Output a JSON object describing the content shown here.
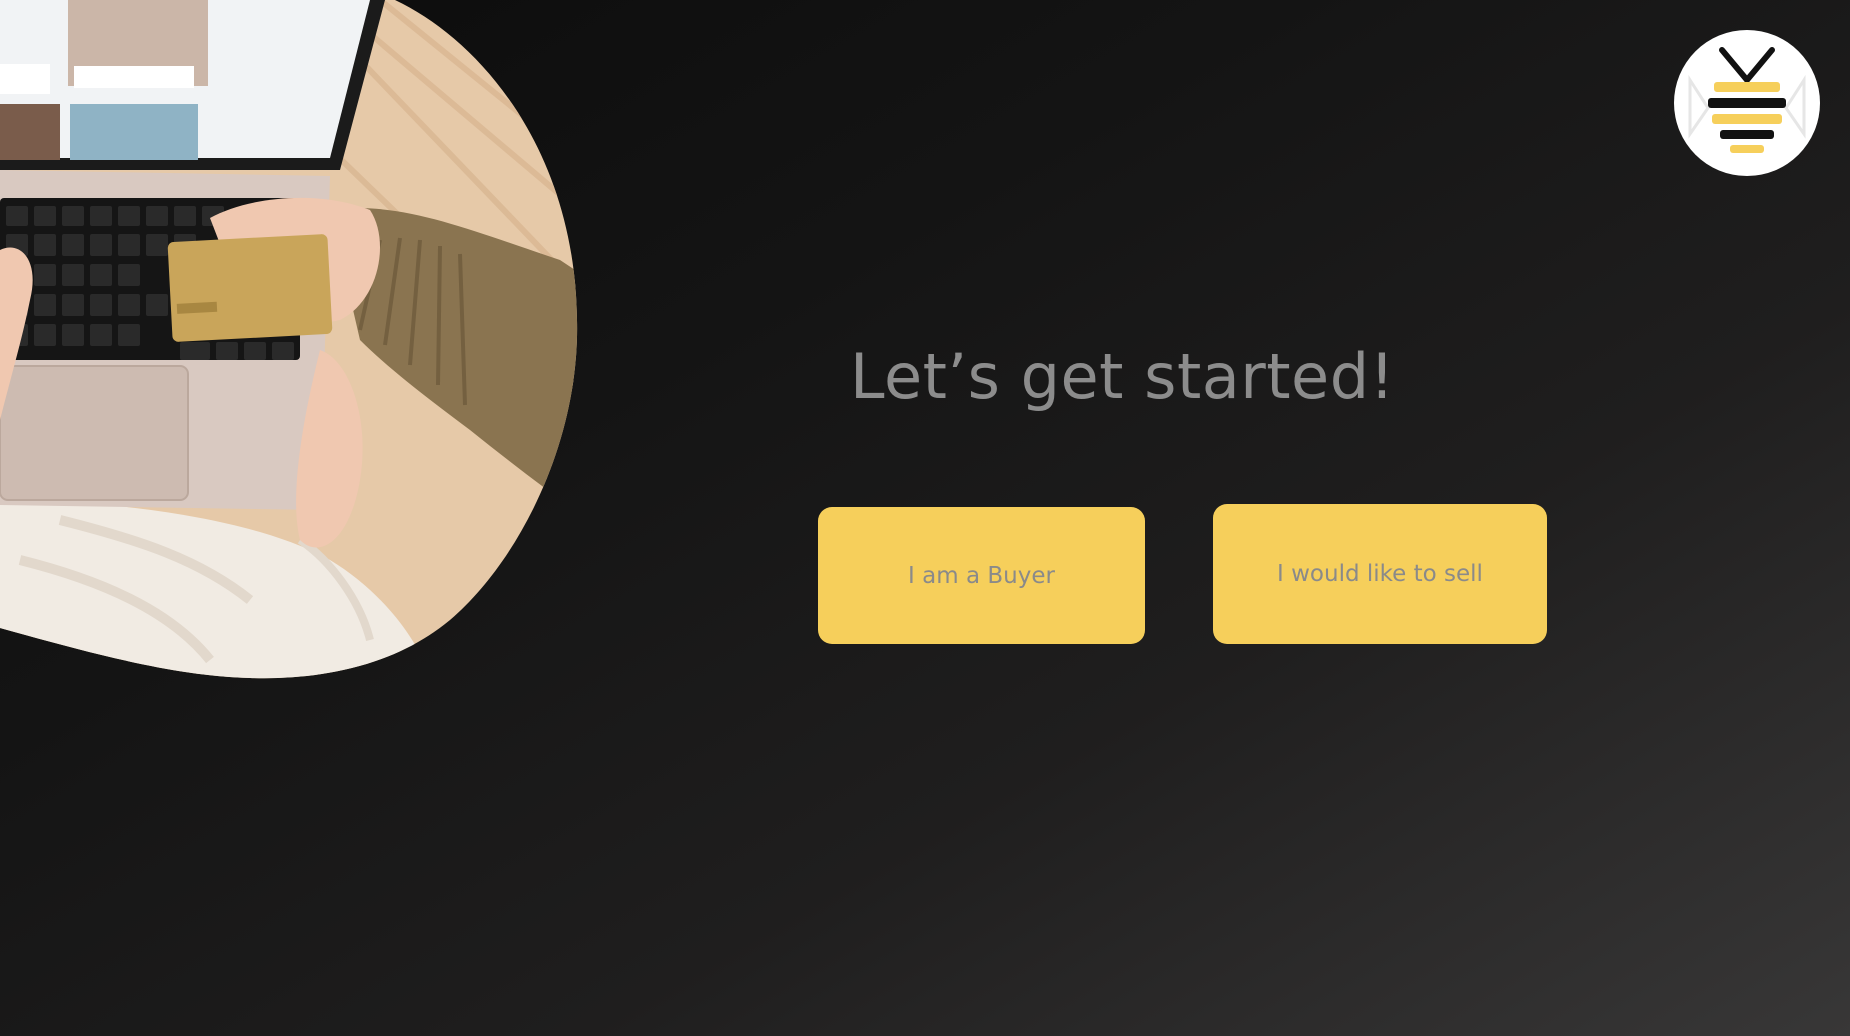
{
  "page": {
    "headline": "Let’s get started!"
  },
  "actions": {
    "buyer_label": "I am a Buyer",
    "seller_label": "I would like to sell"
  },
  "icons": {
    "brand": "bee-logo-icon"
  },
  "colors": {
    "accent": "#f6cf5b",
    "button_text": "#8a8a8a",
    "headline": "#8c8c8c",
    "background_dark": "#0b0b0b",
    "background_light": "#383737"
  }
}
